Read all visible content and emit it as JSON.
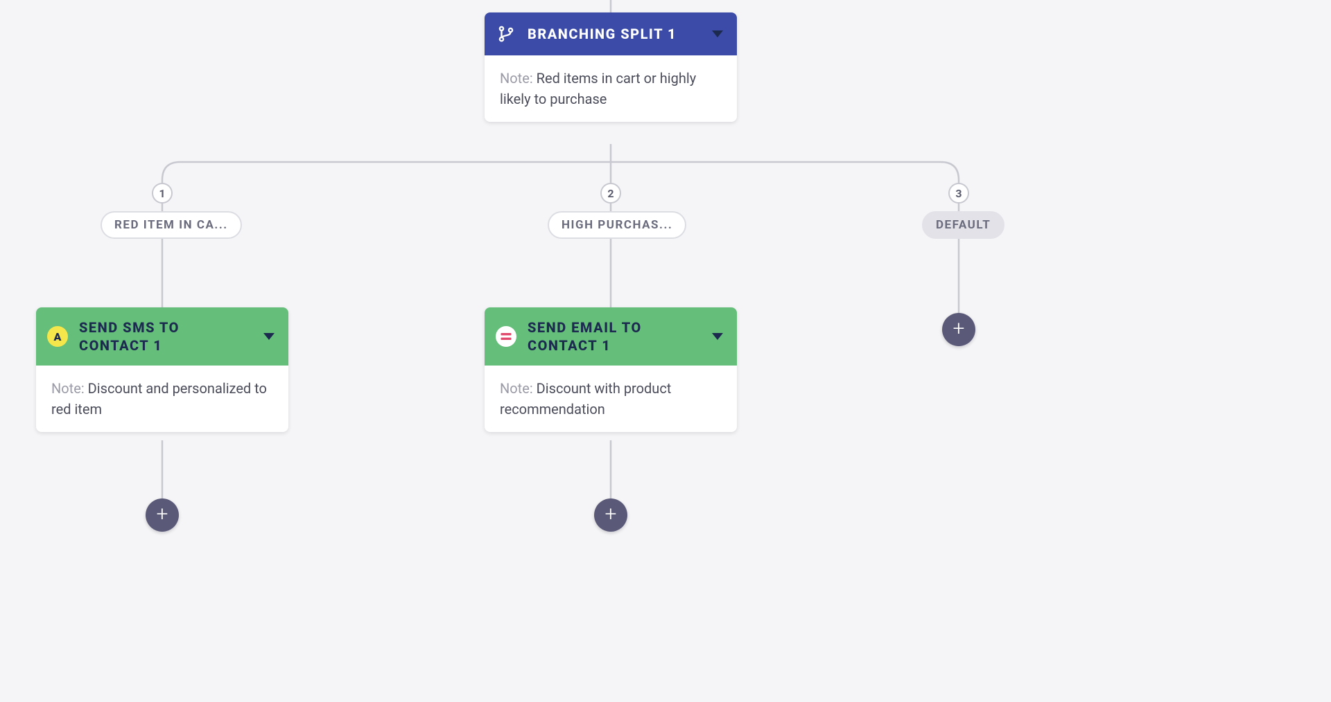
{
  "root_node": {
    "title": "BRANCHING SPLIT 1",
    "note_label": "Note:",
    "note_text": "Red items in cart or highly likely to purchase"
  },
  "branches": [
    {
      "number": "1",
      "pill": "RED ITEM IN CA...",
      "node": {
        "title": "SEND SMS TO CONTACT 1",
        "icon_glyph": "A",
        "note_label": "Note:",
        "note_text": "Discount and personalized to red item"
      }
    },
    {
      "number": "2",
      "pill": "HIGH PURCHAS...",
      "node": {
        "title": "SEND EMAIL TO CONTACT 1",
        "icon_glyph": "≡",
        "note_label": "Note:",
        "note_text": "Discount with product recommendation"
      }
    },
    {
      "number": "3",
      "pill": "DEFAULT",
      "is_default": true
    }
  ],
  "colors": {
    "blue": "#3b4ba7",
    "green": "#65bf7a",
    "connector": "#c8c9d0",
    "addbtn": "#5a5a78"
  }
}
